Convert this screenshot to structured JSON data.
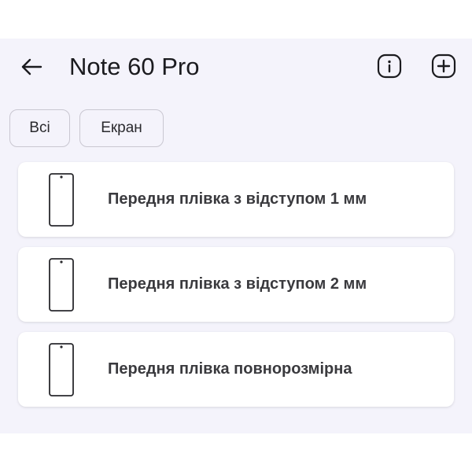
{
  "header": {
    "title": "Note 60 Pro",
    "back_icon": "arrow-left-icon",
    "info_icon": "info-icon",
    "add_icon": "add-icon"
  },
  "filters": [
    {
      "label": "Всі"
    },
    {
      "label": "Екран"
    }
  ],
  "items": [
    {
      "label": "Передня плівка з відступом 1 мм",
      "icon": "phone-outline-icon"
    },
    {
      "label": "Передня плівка з відступом 2 мм",
      "icon": "phone-outline-icon"
    },
    {
      "label": "Передня плівка повнорозмірна",
      "icon": "phone-outline-icon"
    }
  ],
  "colors": {
    "background": "#f4f3fb",
    "card": "#ffffff",
    "text": "#1b1b1f"
  }
}
